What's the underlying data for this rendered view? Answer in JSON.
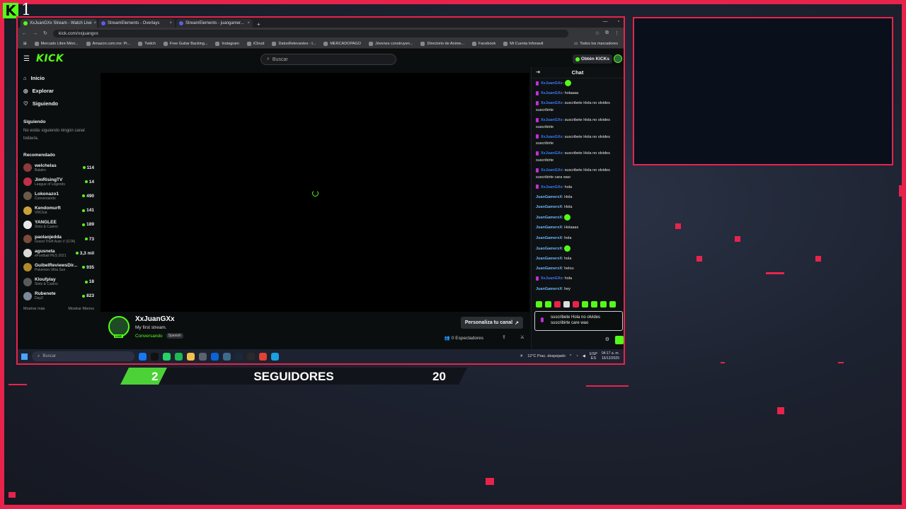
{
  "overlay": {
    "logo_letter": "K",
    "corner_number": "1",
    "followers_goal": {
      "current": "2",
      "label": "SEGUIDORES",
      "goal": "20",
      "progress": 0.1
    },
    "accent_color": "#e8234b",
    "kick_green": "#53fc18"
  },
  "browser": {
    "tabs": [
      {
        "label": "XxJuanGXx Stream - Watch Live",
        "icon": "kick-icon",
        "active": true
      },
      {
        "label": "StreamElements - Overlays",
        "icon": "streamelements-icon"
      },
      {
        "label": "StreamElements - juangamer...",
        "icon": "streamelements-icon"
      }
    ],
    "new_tab": "+",
    "url": "kick.com/xxjuangxx",
    "bookmarks": [
      "Mercado Libre Méxi...",
      "Amazon.com.mx: Pr...",
      "Twitch",
      "Free Guitar Backing...",
      "Instagram",
      "iCloud",
      "DatosRelevantes - I...",
      "MERCADOPAGO",
      "Jóvenes construyen...",
      "Directorio de Anime...",
      "Facebook",
      "Mi Cuenta Infonavit"
    ],
    "bookmarks_more": "Todos los marcadores"
  },
  "kick": {
    "logo": "KICK",
    "search_placeholder": "Buscar",
    "cta": "Obtén KICKs",
    "nav": [
      {
        "label": "Inicio",
        "icon": "home-icon"
      },
      {
        "label": "Explorar",
        "icon": "compass-icon"
      },
      {
        "label": "Siguiendo",
        "icon": "heart-icon"
      }
    ],
    "following_title": "Siguiendo",
    "following_empty": "No estás siguiendo ningún canal todavía.",
    "recommended_title": "Recomendado",
    "recommended": [
      {
        "name": "welchelas",
        "category": "Balatro",
        "viewers": "114"
      },
      {
        "name": "JimRisingTV",
        "category": "League of Legends",
        "viewers": "14"
      },
      {
        "name": "Lokonazo1",
        "category": "Conversando",
        "viewers": "490"
      },
      {
        "name": "Kendomurft",
        "category": "VRChat",
        "viewers": "141"
      },
      {
        "name": "YANGLEE",
        "category": "Slots & Casino",
        "viewers": "189"
      },
      {
        "name": "paolaojedda",
        "category": "Grand Theft Auto V (GTA)",
        "viewers": "73"
      },
      {
        "name": "agusneta",
        "category": "eFootball PES 2021",
        "viewers": "3,3 mil"
      },
      {
        "name": "GuibelReviewsDir...",
        "category": "Pokemon Ultra Sun",
        "viewers": "935"
      },
      {
        "name": "Kloufplay",
        "category": "Slots & Casino",
        "viewers": "18"
      },
      {
        "name": "Rubenete",
        "category": "DayZ",
        "viewers": "823"
      }
    ],
    "show_more": "Mostrar más",
    "show_less": "Mostrar Menos",
    "stream": {
      "live_badge": "LIVE",
      "channel": "XxJuanGXx",
      "title": "My first stream.",
      "category": "Conversando",
      "language": "Spanish",
      "customize": "Personaliza tu canal",
      "viewers": "0 Espectadores"
    },
    "chat": {
      "title": "Chat",
      "messages": [
        {
          "user": "XxJuanGXx",
          "text": "",
          "emote": true,
          "badge": true,
          "style": "u1"
        },
        {
          "user": "XxJuanGXx",
          "text": "holaaaa",
          "badge": true,
          "style": "u1"
        },
        {
          "user": "XxJuanGXx",
          "text": "suscribete Hola no olvides suscribirte",
          "badge": true,
          "style": "u1"
        },
        {
          "user": "XxJuanGXx",
          "text": "suscribete Hola no olvides suscribirte",
          "badge": true,
          "style": "u1"
        },
        {
          "user": "XxJuanGXx",
          "text": "suscribete Hola no olvides suscribirte",
          "badge": true,
          "style": "u1"
        },
        {
          "user": "XxJuanGXx",
          "text": "suscribete Hola no olvides suscribirte",
          "badge": true,
          "style": "u1"
        },
        {
          "user": "XxJuanGXx",
          "text": "suscribete Hola no olvides suscribirte cara wao",
          "badge": true,
          "style": "u1"
        },
        {
          "user": "XxJuanGXx",
          "text": "hola",
          "badge": true,
          "style": "u1"
        },
        {
          "user": "JuanGamerxX",
          "text": "Hola",
          "style": "u2"
        },
        {
          "user": "JuanGamerxX",
          "text": "Hola",
          "style": "u2"
        },
        {
          "user": "JuanGamerxX",
          "text": "",
          "emote": true,
          "style": "u2"
        },
        {
          "user": "JuanGamerxX",
          "text": "Holaaas",
          "style": "u2"
        },
        {
          "user": "JuanGamerxX",
          "text": "hola",
          "style": "u2"
        },
        {
          "user": "JuanGamerxX",
          "text": "",
          "emote": true,
          "style": "u2"
        },
        {
          "user": "JuanGamerxX",
          "text": "hola",
          "style": "u2"
        },
        {
          "user": "JuanGamerxX",
          "text": "helou",
          "style": "u2"
        },
        {
          "user": "XxJuanGXx",
          "text": "hola",
          "badge": true,
          "style": "u1"
        },
        {
          "user": "JuanGamerxX",
          "text": "hey",
          "style": "u2"
        }
      ],
      "input_text": "suscribete Hola no olvides suscribirte care wao"
    }
  },
  "taskbar": {
    "search_placeholder": "Buscar",
    "weather": "12°C  Prac. despejado",
    "lang": "ESP\nES",
    "time": "04:17 a. m.",
    "date": "16/12/2025"
  }
}
